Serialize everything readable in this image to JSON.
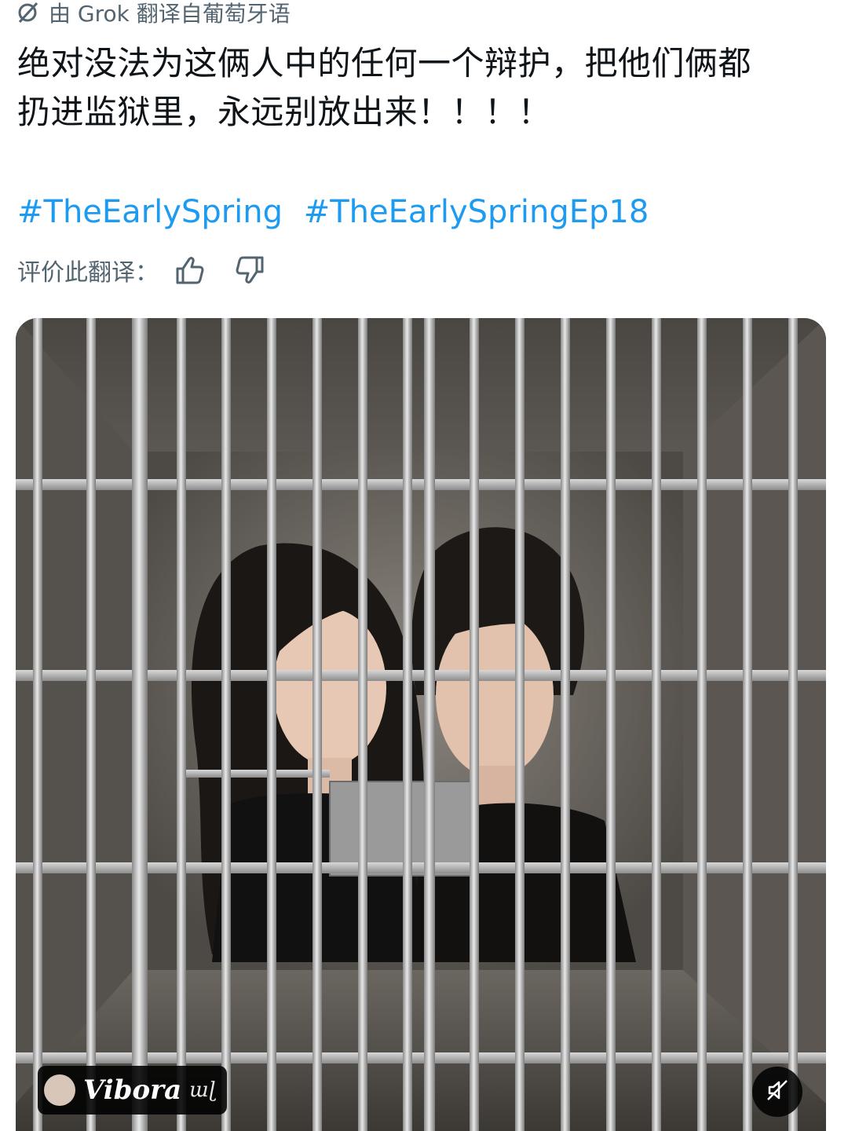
{
  "translation": {
    "label": "由 Grok 翻译自葡萄牙语",
    "icon": "grok-icon"
  },
  "post": {
    "text": "绝对没法为这俩人中的任何一个辩护，把他们俩都\n扔进监狱里，永远别放出来！！！！",
    "hashtags": [
      "#TheEarlySpring",
      "#TheEarlySpringEp18"
    ]
  },
  "rating": {
    "label": "评价此翻译：",
    "like_icon": "thumbs-up-icon",
    "dislike_icon": "thumbs-down-icon"
  },
  "media": {
    "watermark_name": "Vibora",
    "watermark_mark": "ɯɭ",
    "mute_icon": "mute-icon"
  },
  "colors": {
    "link": "#1d9bf0",
    "secondary_text": "#536471",
    "primary_text": "#0f1419"
  }
}
